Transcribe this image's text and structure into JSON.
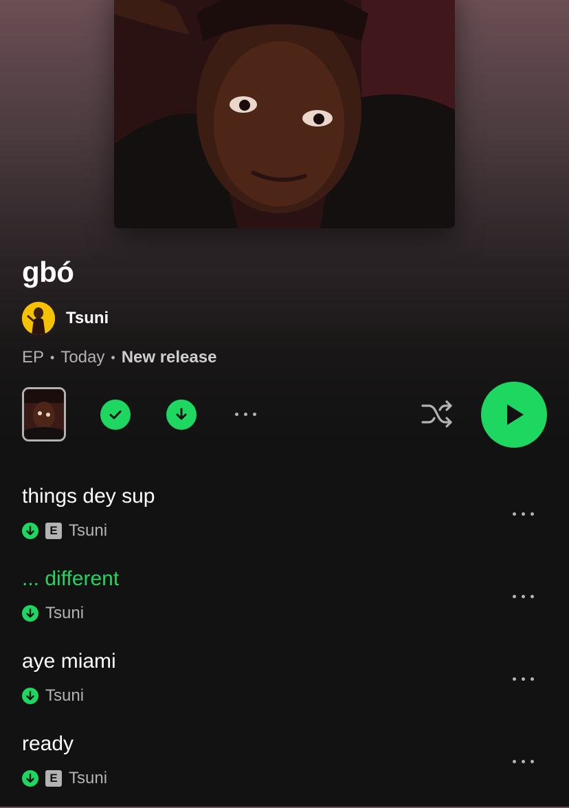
{
  "album": {
    "title": "gbó",
    "artist": "Tsuni",
    "type": "EP",
    "date": "Today",
    "release_tag": "New release"
  },
  "controls": {
    "saved_icon": "check-circle-icon",
    "download_icon": "download-circle-icon",
    "more_icon": "more-dots-icon",
    "shuffle_icon": "shuffle-icon",
    "play_icon": "play-icon"
  },
  "tracks": [
    {
      "title": "things dey sup",
      "artist": "Tsuni",
      "explicit": true,
      "playing": false,
      "explicit_label": "E"
    },
    {
      "title": "... different",
      "artist": "Tsuni",
      "explicit": false,
      "playing": true
    },
    {
      "title": "aye miami",
      "artist": "Tsuni",
      "explicit": false,
      "playing": false
    },
    {
      "title": "ready",
      "artist": "Tsuni",
      "explicit": true,
      "playing": false,
      "explicit_label": "E"
    }
  ],
  "colors": {
    "accent": "#1ed760",
    "background": "#121212",
    "text_secondary": "#b3b3b3"
  }
}
